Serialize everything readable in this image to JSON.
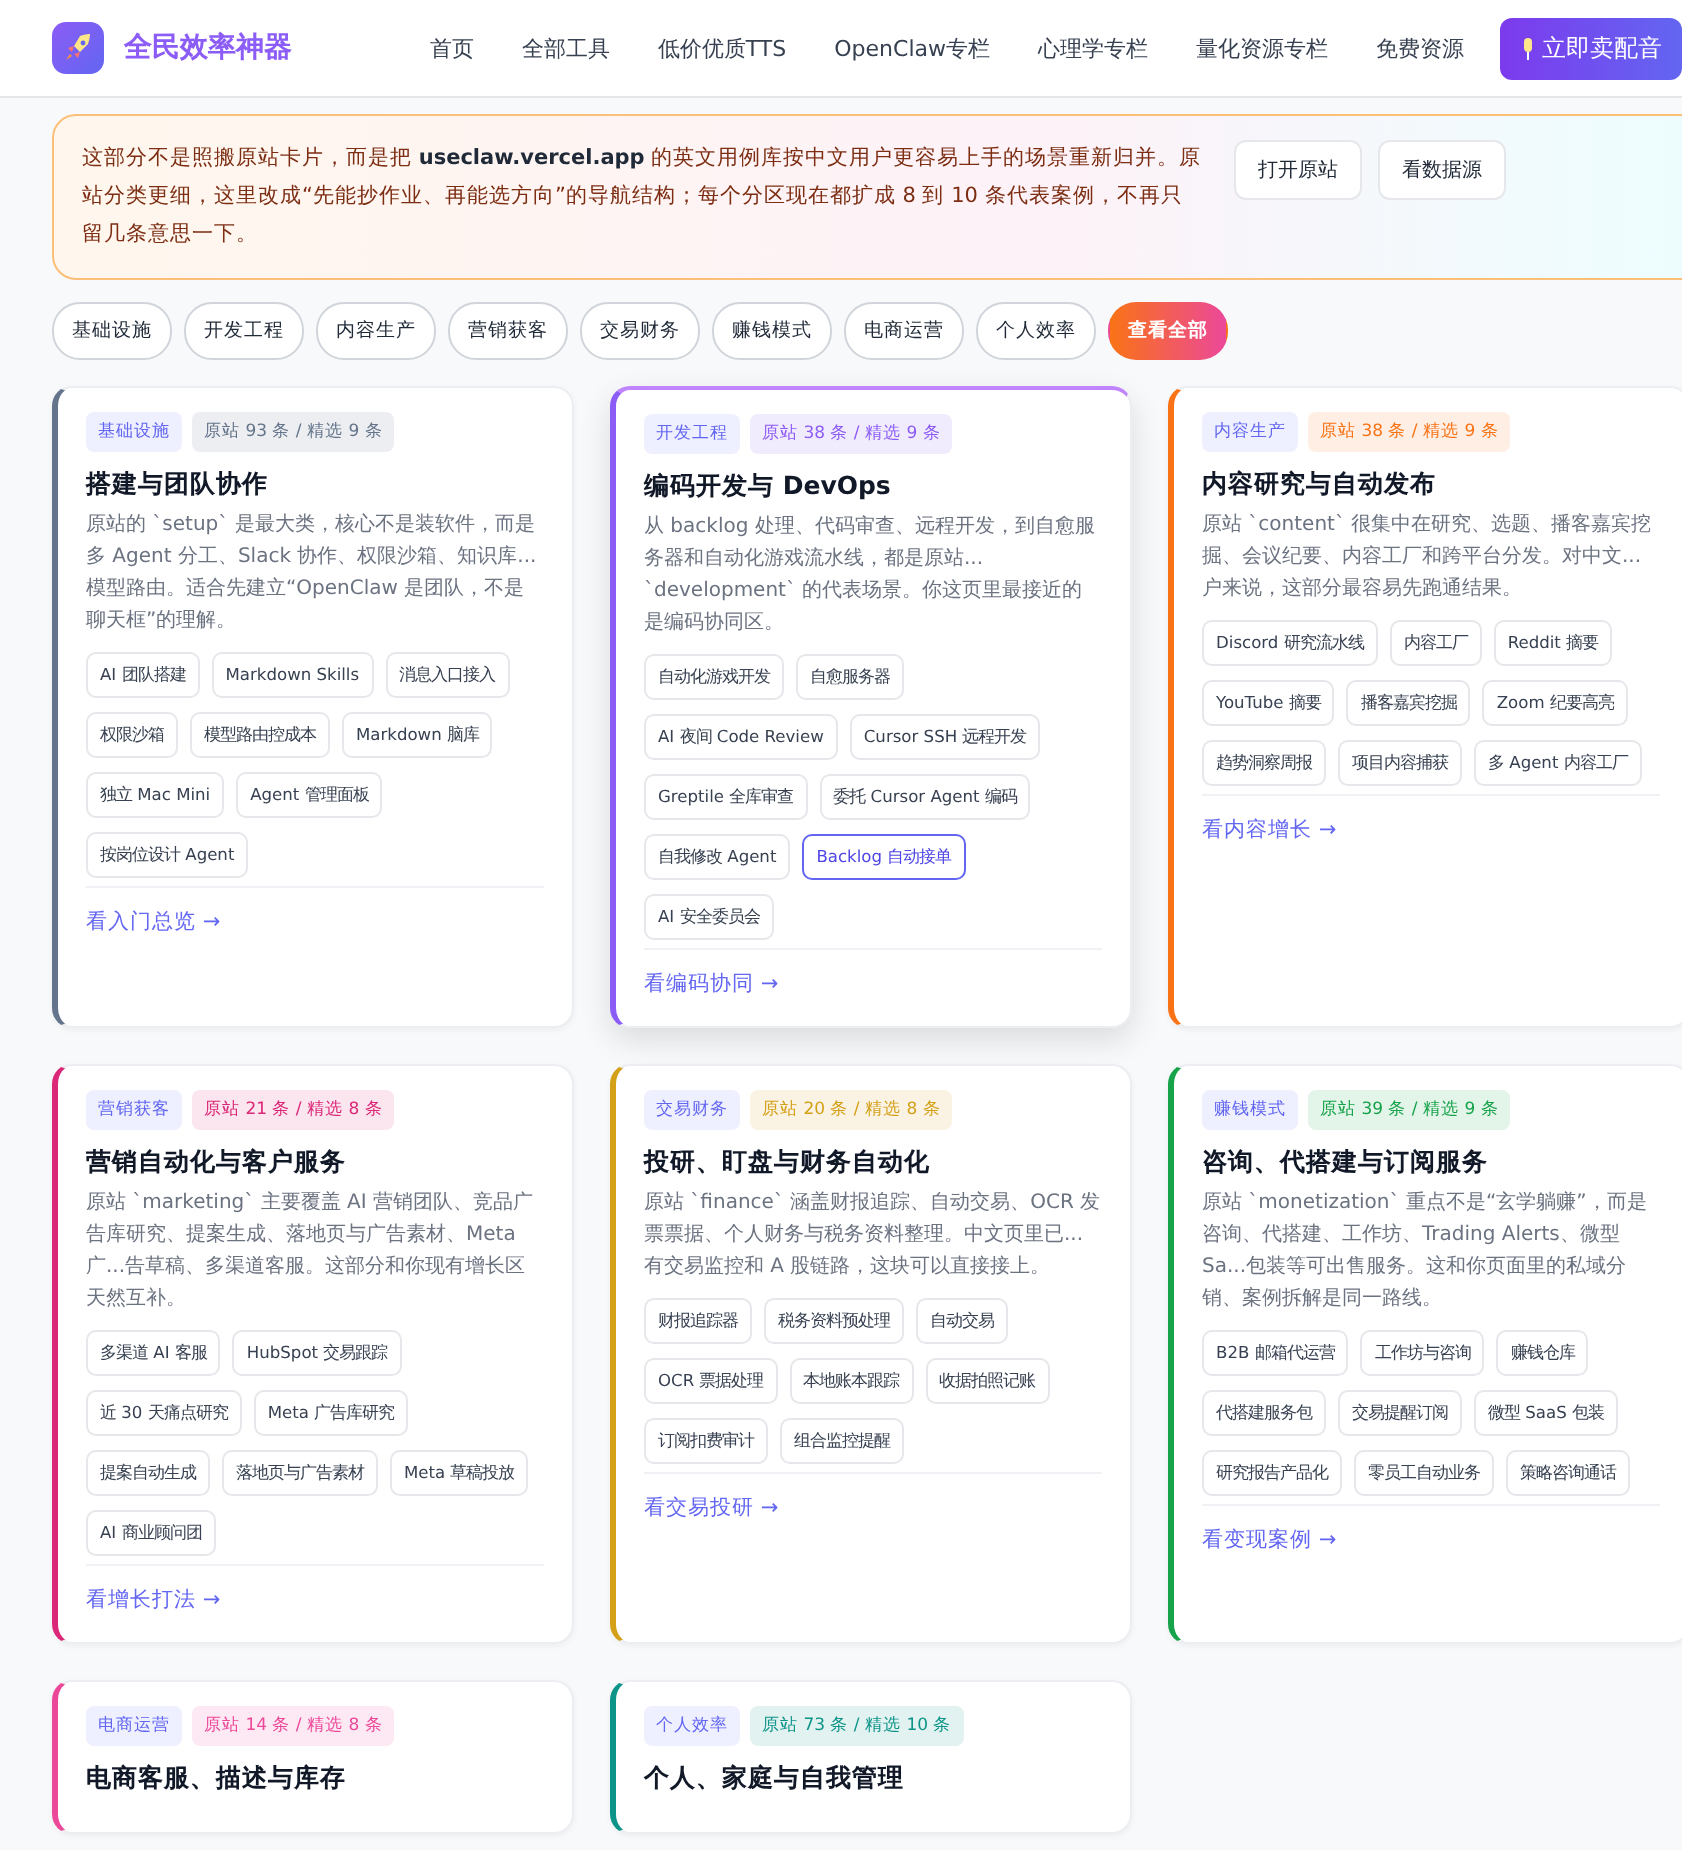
{
  "brand": {
    "name": "全民效率神器"
  },
  "nav": [
    {
      "label": "首页"
    },
    {
      "label": "全部工具"
    },
    {
      "label": "低价优质TTS"
    },
    {
      "label": "OpenClaw专栏"
    },
    {
      "label": "心理学专栏"
    },
    {
      "label": "量化资源专栏"
    },
    {
      "label": "免费资源"
    }
  ],
  "cta": {
    "label": "立即卖配音"
  },
  "notice": {
    "text": "这部分不是照搬原站卡片，而是把 **useclaw.vercel.app** 的英文用例库按中文用户更容易上手的场景重新归并。原站分类更细，这里改成“先能抄作业、再能选方向”的导航结构；每个分区现在都扩成 8 到 10 条代表案例，不再只留几条意思一下。",
    "buttons": [
      "打开原站",
      "看数据源"
    ]
  },
  "filters": [
    {
      "label": "基础设施",
      "selected": false
    },
    {
      "label": "开发工程",
      "selected": false
    },
    {
      "label": "内容生产",
      "selected": false
    },
    {
      "label": "营销获客",
      "selected": false
    },
    {
      "label": "交易财务",
      "selected": false
    },
    {
      "label": "赚钱模式",
      "selected": false
    },
    {
      "label": "电商运营",
      "selected": false
    },
    {
      "label": "个人效率",
      "selected": false
    },
    {
      "label": "查看全部",
      "selected": true
    }
  ],
  "cards": [
    {
      "category": "基础设施",
      "count": "原站 93 条 / 精选 9 条",
      "color": "#64748b",
      "selected": false,
      "title": "搭建与团队协作",
      "description": "原站的 `setup` 是最大类，核心不是装软件，而是多 Agent 分工、Slack 协作、权限沙箱、知识库...模型路由。适合先建立“OpenClaw 是团队，不是聊天框”的理解。",
      "tags": [
        {
          "label": "AI 团队搭建",
          "selected": false
        },
        {
          "label": "Markdown Skills",
          "selected": false
        },
        {
          "label": "消息入口接入",
          "selected": false
        },
        {
          "label": "权限沙箱",
          "selected": false
        },
        {
          "label": "模型路由控成本",
          "selected": false
        },
        {
          "label": "Markdown 脑库",
          "selected": false
        },
        {
          "label": "独立 Mac Mini",
          "selected": false
        },
        {
          "label": "Agent 管理面板",
          "selected": false
        },
        {
          "label": "按岗位设计 Agent",
          "selected": false
        }
      ],
      "link": "看入门总览 →"
    },
    {
      "category": "开发工程",
      "count": "原站 38 条 / 精选 9 条",
      "color": "#8b5cf6",
      "selected": true,
      "title": "编码开发与 DevOps",
      "description": "从 backlog 处理、代码审查、远程开发，到自愈服务器和自动化游戏流水线，都是原站... `development` 的代表场景。你这页里最接近的是编码协同区。",
      "tags": [
        {
          "label": "自动化游戏开发",
          "selected": false
        },
        {
          "label": "自愈服务器",
          "selected": false
        },
        {
          "label": "AI 夜间 Code Review",
          "selected": false
        },
        {
          "label": "Cursor SSH 远程开发",
          "selected": false
        },
        {
          "label": "Greptile 全库审查",
          "selected": false
        },
        {
          "label": "委托 Cursor Agent 编码",
          "selected": false
        },
        {
          "label": "自我修改 Agent",
          "selected": false
        },
        {
          "label": "Backlog 自动接单",
          "selected": true
        },
        {
          "label": "AI 安全委员会",
          "selected": false
        }
      ],
      "link": "看编码协同 →"
    },
    {
      "category": "内容生产",
      "count": "原站 38 条 / 精选 9 条",
      "color": "#f97316",
      "selected": false,
      "title": "内容研究与自动发布",
      "description": "原站 `content` 很集中在研究、选题、播客嘉宾挖掘、会议纪要、内容工厂和跨平台分发。对中文...户来说，这部分最容易先跑通结果。",
      "tags": [
        {
          "label": "Discord 研究流水线",
          "selected": false
        },
        {
          "label": "内容工厂",
          "selected": false
        },
        {
          "label": "Reddit 摘要",
          "selected": false
        },
        {
          "label": "YouTube 摘要",
          "selected": false
        },
        {
          "label": "播客嘉宾挖掘",
          "selected": false
        },
        {
          "label": "Zoom 纪要高亮",
          "selected": false
        },
        {
          "label": "趋势洞察周报",
          "selected": false
        },
        {
          "label": "项目内容捕获",
          "selected": false
        },
        {
          "label": "多 Agent 内容工厂",
          "selected": false
        }
      ],
      "link": "看内容增长 →"
    },
    {
      "category": "营销获客",
      "count": "原站 21 条 / 精选 8 条",
      "color": "#db2777",
      "selected": false,
      "title": "营销自动化与客户服务",
      "description": "原站 `marketing` 主要覆盖 AI 营销团队、竞品广告库研究、提案生成、落地页与广告素材、Meta 广...告草稿、多渠道客服。这部分和你现有增长区天然互补。",
      "tags": [
        {
          "label": "多渠道 AI 客服",
          "selected": false
        },
        {
          "label": "HubSpot 交易跟踪",
          "selected": false
        },
        {
          "label": "近 30 天痛点研究",
          "selected": false
        },
        {
          "label": "Meta 广告库研究",
          "selected": false
        },
        {
          "label": "提案自动生成",
          "selected": false
        },
        {
          "label": "落地页与广告素材",
          "selected": false
        },
        {
          "label": "Meta 草稿投放",
          "selected": false
        },
        {
          "label": "AI 商业顾问团",
          "selected": false
        }
      ],
      "link": "看增长打法 →"
    },
    {
      "category": "交易财务",
      "count": "原站 20 条 / 精选 8 条",
      "color": "#d4a017",
      "selected": false,
      "title": "投研、盯盘与财务自动化",
      "description": "原站 `finance` 涵盖财报追踪、自动交易、OCR 发票票据、个人财务与税务资料整理。中文页里已...有交易监控和 A 股链路，这块可以直接接上。",
      "tags": [
        {
          "label": "财报追踪器",
          "selected": false
        },
        {
          "label": "税务资料预处理",
          "selected": false
        },
        {
          "label": "自动交易",
          "selected": false
        },
        {
          "label": "OCR 票据处理",
          "selected": false
        },
        {
          "label": "本地账本跟踪",
          "selected": false
        },
        {
          "label": "收据拍照记账",
          "selected": false
        },
        {
          "label": "订阅扣费审计",
          "selected": false
        },
        {
          "label": "组合监控提醒",
          "selected": false
        }
      ],
      "link": "看交易投研 →"
    },
    {
      "category": "赚钱模式",
      "count": "原站 39 条 / 精选 9 条",
      "color": "#16a34a",
      "selected": false,
      "title": "咨询、代搭建与订阅服务",
      "description": "原站 `monetization` 重点不是“玄学躺赚”，而是咨询、代搭建、工作坊、Trading Alerts、微型 Sa...包装等可出售服务。这和你页面里的私域分销、案例拆解是同一路线。",
      "tags": [
        {
          "label": "B2B 邮箱代运营",
          "selected": false
        },
        {
          "label": "工作坊与咨询",
          "selected": false
        },
        {
          "label": "赚钱仓库",
          "selected": false
        },
        {
          "label": "代搭建服务包",
          "selected": false
        },
        {
          "label": "交易提醒订阅",
          "selected": false
        },
        {
          "label": "微型 SaaS 包装",
          "selected": false
        },
        {
          "label": "研究报告产品化",
          "selected": false
        },
        {
          "label": "零员工自动业务",
          "selected": false
        },
        {
          "label": "策略咨询通话",
          "selected": false
        }
      ],
      "link": "看变现案例 →"
    },
    {
      "category": "电商运营",
      "count": "原站 14 条 / 精选 8 条",
      "color": "#ec4899",
      "selected": false,
      "title": "电商客服、描述与库存"
    },
    {
      "category": "个人效率",
      "count": "原站 73 条 / 精选 10 条",
      "color": "#0d9488",
      "selected": false,
      "title": "个人、家庭与自我管理"
    }
  ]
}
